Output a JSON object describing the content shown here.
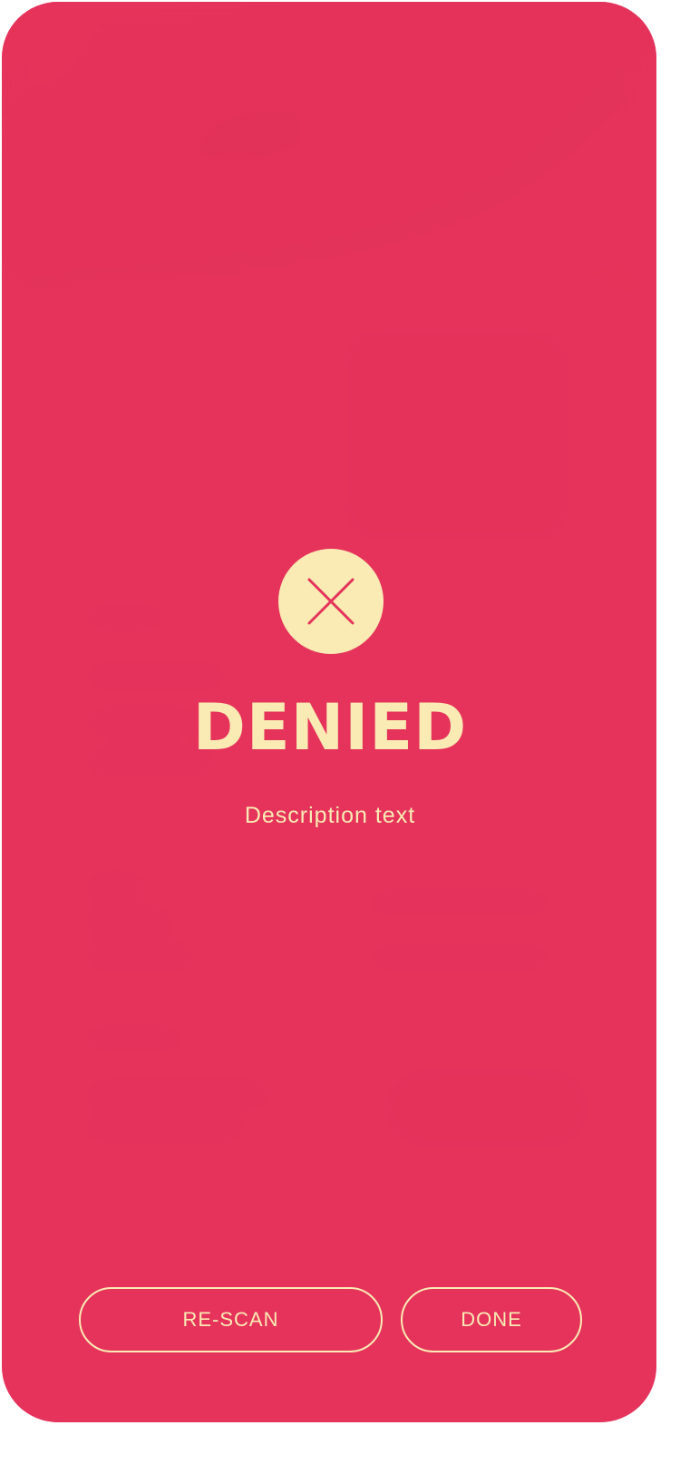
{
  "status": {
    "icon": "close-icon",
    "title": "DENIED",
    "description": "Description text"
  },
  "actions": {
    "rescan_label": "RE-SCAN",
    "done_label": "DONE"
  },
  "colors": {
    "background": "#e5335c",
    "accent": "#f9ebb3"
  }
}
